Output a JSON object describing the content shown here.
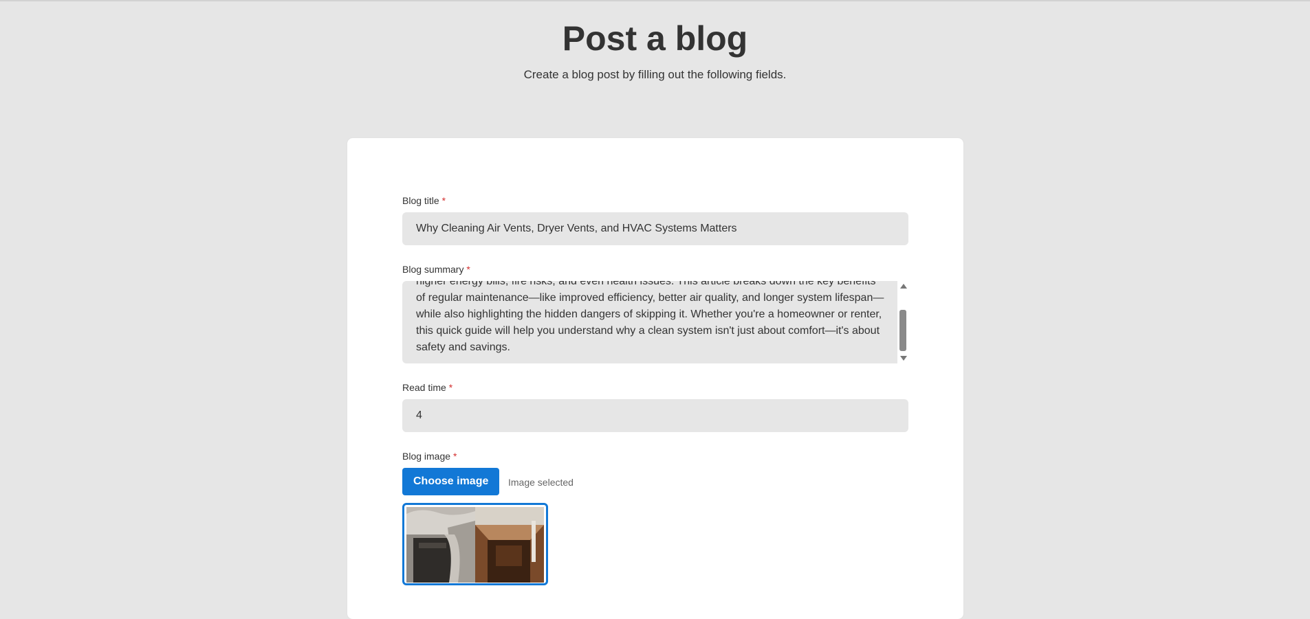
{
  "header": {
    "title": "Post a blog",
    "subtitle": "Create a blog post by filling out the following fields."
  },
  "form": {
    "required_marker": "*",
    "blog_title": {
      "label": "Blog title",
      "value": "Why Cleaning Air Vents, Dryer Vents, and HVAC Systems Matters"
    },
    "blog_summary": {
      "label": "Blog summary",
      "lines": [
        "higher energy bills, fire risks, and even health issues. This article breaks down the key benefits",
        "of regular maintenance—like improved efficiency, better air quality, and longer system lifespan—",
        "while also highlighting the hidden dangers of skipping it. Whether you're a homeowner or renter,",
        "this quick guide will help you understand why a clean system isn't just about comfort—it's about",
        "safety and savings."
      ]
    },
    "read_time": {
      "label": "Read time",
      "value": "4"
    },
    "blog_image": {
      "label": "Blog image",
      "button_label": "Choose image",
      "status": "Image selected",
      "preview_icon": "dirty-vs-clean-duct-photo"
    }
  },
  "colors": {
    "background": "#e6e6e6",
    "card": "#ffffff",
    "accent": "#1278d6",
    "required": "#d32f2f",
    "text": "#333333"
  }
}
